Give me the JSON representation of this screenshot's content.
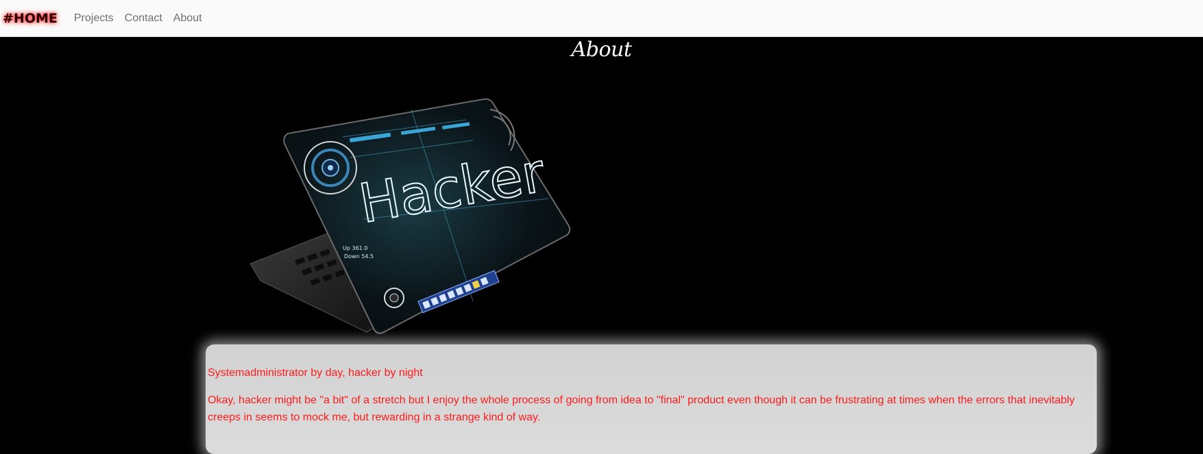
{
  "nav": {
    "brand": "#HOME",
    "links": [
      "Projects",
      "Contact",
      "About"
    ]
  },
  "page": {
    "title": "About"
  },
  "hero": {
    "image_icon": "hacker-laptop-illustration",
    "screen_text": "Hacker",
    "stat_up": "Up 361.0",
    "stat_down": "Down 54.5"
  },
  "card": {
    "tagline": "Systemadministrator by day, hacker by night",
    "body": "Okay, hacker might be \"a bit\" of a stretch but I enjoy the whole process of going from idea to \"final\" product even though it can be frustrating at times when the errors that inevitably creeps in seems to mock me, but rewarding in a strange kind of way."
  },
  "colors": {
    "background": "#000000",
    "navbar": "#fafafa",
    "card_text": "#ff1a1a",
    "brand_glow": "#ff2a2a"
  }
}
